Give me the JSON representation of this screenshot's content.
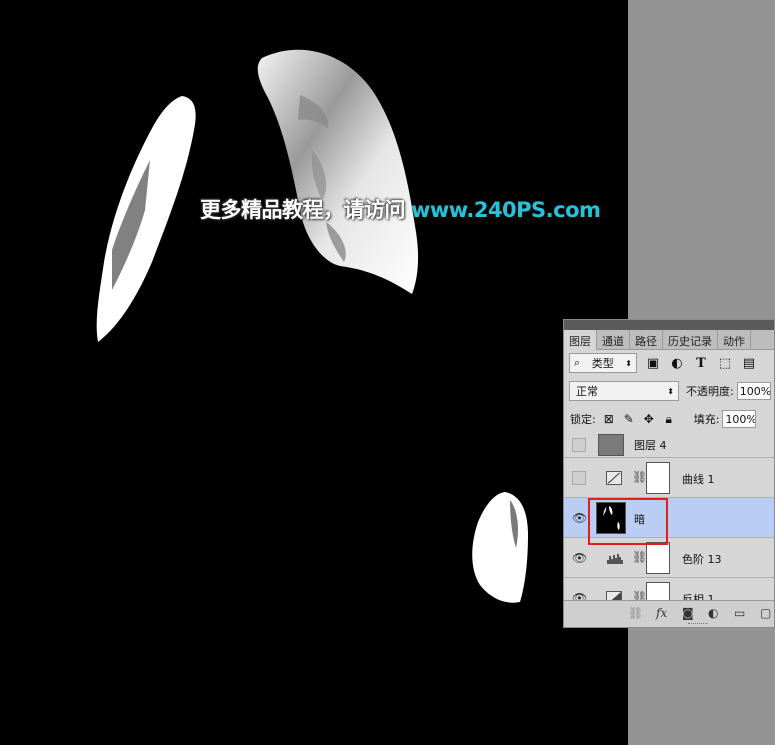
{
  "watermark": {
    "cn": "更多精品教程，请访问",
    "url": "www.240PS.com",
    "url_color": "#27c2d9"
  },
  "layers_panel": {
    "tabs": [
      "图层",
      "通道",
      "路径",
      "历史记录",
      "动作"
    ],
    "active_tab": "图层",
    "filter": {
      "label": "类型",
      "search_icon": "search-icon",
      "filter_icons": [
        "image-icon",
        "adjustment-icon",
        "type-icon",
        "shape-icon",
        "smart-object-icon"
      ]
    },
    "blend_mode": "正常",
    "opacity_label": "不透明度:",
    "opacity_value": "100%",
    "lock_label": "锁定:",
    "lock_icons": [
      "lock-transparent-icon",
      "lock-brush-icon",
      "lock-move-icon",
      "lock-all-icon"
    ],
    "fill_label": "填充:",
    "fill_value": "100%",
    "layers": [
      {
        "name": "图层 4",
        "visible": false,
        "type": "pixel",
        "thumb_color": "#7a7a7a"
      },
      {
        "name": "曲线 1",
        "visible": false,
        "type": "curves",
        "has_mask": true
      },
      {
        "name": "暗",
        "visible": true,
        "type": "pixel-mask",
        "selected": true
      },
      {
        "name": "色阶 13",
        "visible": true,
        "type": "levels",
        "has_mask": true
      },
      {
        "name": "反相 1",
        "visible": true,
        "type": "invert",
        "has_mask": true
      }
    ],
    "selected_color": "#b9cdf5",
    "bottom_icons": [
      "link-icon",
      "fx-icon",
      "mask-icon",
      "adjustment-layer-icon",
      "group-folder-icon",
      "new-layer-icon"
    ],
    "fx_label": "fx"
  },
  "highlight_color": "#e01e1e"
}
